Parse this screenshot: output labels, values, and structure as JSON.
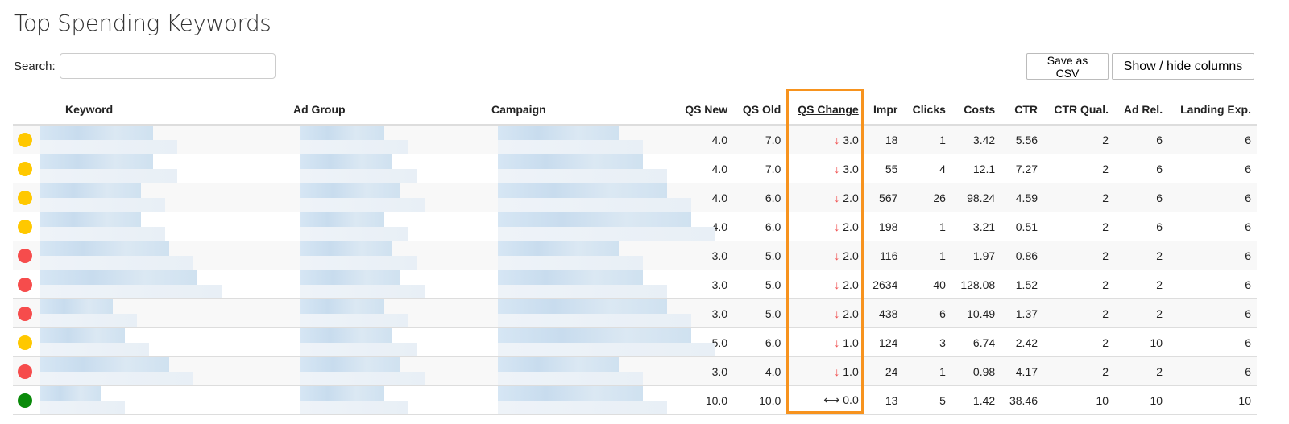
{
  "title": "Top Spending Keywords",
  "search": {
    "label": "Search:",
    "value": ""
  },
  "buttons": {
    "csv": "Save as CSV",
    "columns": "Show / hide columns"
  },
  "headers": [
    "Keyword",
    "Ad Group",
    "Campaign",
    "QS New",
    "QS Old",
    "QS Change",
    "Impr",
    "Clicks",
    "Costs",
    "CTR",
    "CTR Qual.",
    "Ad Rel.",
    "Landing Exp."
  ],
  "colors": {
    "yellow": "#ffc800",
    "red": "#f64c4c",
    "green": "#0a8a0a",
    "highlight": "#f7931e"
  },
  "rows": [
    {
      "status": "yellow",
      "qs_new": "4.0",
      "qs_old": "7.0",
      "dir": "down",
      "change": "3.0",
      "impr": "18",
      "clicks": "1",
      "costs": "3.42",
      "ctr": "5.56",
      "ctr_qual": "2",
      "ad_rel": "6",
      "landing": "6"
    },
    {
      "status": "yellow",
      "qs_new": "4.0",
      "qs_old": "7.0",
      "dir": "down",
      "change": "3.0",
      "impr": "55",
      "clicks": "4",
      "costs": "12.1",
      "ctr": "7.27",
      "ctr_qual": "2",
      "ad_rel": "6",
      "landing": "6"
    },
    {
      "status": "yellow",
      "qs_new": "4.0",
      "qs_old": "6.0",
      "dir": "down",
      "change": "2.0",
      "impr": "567",
      "clicks": "26",
      "costs": "98.24",
      "ctr": "4.59",
      "ctr_qual": "2",
      "ad_rel": "6",
      "landing": "6"
    },
    {
      "status": "yellow",
      "qs_new": "4.0",
      "qs_old": "6.0",
      "dir": "down",
      "change": "2.0",
      "impr": "198",
      "clicks": "1",
      "costs": "3.21",
      "ctr": "0.51",
      "ctr_qual": "2",
      "ad_rel": "6",
      "landing": "6"
    },
    {
      "status": "red",
      "qs_new": "3.0",
      "qs_old": "5.0",
      "dir": "down",
      "change": "2.0",
      "impr": "116",
      "clicks": "1",
      "costs": "1.97",
      "ctr": "0.86",
      "ctr_qual": "2",
      "ad_rel": "2",
      "landing": "6"
    },
    {
      "status": "red",
      "qs_new": "3.0",
      "qs_old": "5.0",
      "dir": "down",
      "change": "2.0",
      "impr": "2634",
      "clicks": "40",
      "costs": "128.08",
      "ctr": "1.52",
      "ctr_qual": "2",
      "ad_rel": "2",
      "landing": "6"
    },
    {
      "status": "red",
      "qs_new": "3.0",
      "qs_old": "5.0",
      "dir": "down",
      "change": "2.0",
      "impr": "438",
      "clicks": "6",
      "costs": "10.49",
      "ctr": "1.37",
      "ctr_qual": "2",
      "ad_rel": "2",
      "landing": "6"
    },
    {
      "status": "yellow",
      "qs_new": "5.0",
      "qs_old": "6.0",
      "dir": "down",
      "change": "1.0",
      "impr": "124",
      "clicks": "3",
      "costs": "6.74",
      "ctr": "2.42",
      "ctr_qual": "2",
      "ad_rel": "10",
      "landing": "6"
    },
    {
      "status": "red",
      "qs_new": "3.0",
      "qs_old": "4.0",
      "dir": "down",
      "change": "1.0",
      "impr": "24",
      "clicks": "1",
      "costs": "0.98",
      "ctr": "4.17",
      "ctr_qual": "2",
      "ad_rel": "2",
      "landing": "6"
    },
    {
      "status": "green",
      "qs_new": "10.0",
      "qs_old": "10.0",
      "dir": "same",
      "change": "0.0",
      "impr": "13",
      "clicks": "5",
      "costs": "1.42",
      "ctr": "38.46",
      "ctr_qual": "10",
      "ad_rel": "10",
      "landing": "10"
    }
  ]
}
